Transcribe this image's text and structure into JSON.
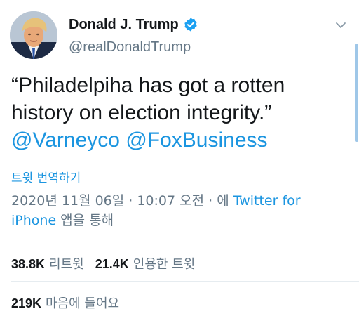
{
  "author": {
    "display_name": "Donald J. Trump",
    "handle": "@realDonaldTrump",
    "verified": true
  },
  "tweet": {
    "text_line1": "“Philadelpiha has got a rotten",
    "text_line2": "history on election integrity.”",
    "mention1": "@Varneyco",
    "mention2": "@FoxBusiness",
    "translate_label": "트윗 번역하기",
    "timestamp": "2020년 11월 06일 · 10:07 오전 · 에 ",
    "source": "Twitter for iPhone",
    "source_suffix": " 앱을 통해"
  },
  "stats": {
    "retweets_count": "38.8K",
    "retweets_label": "리트윗",
    "quotes_count": "21.4K",
    "quotes_label": "인용한 트윗",
    "likes_count": "219K",
    "likes_label": "마음에 들어요"
  },
  "colors": {
    "link": "#1b95e0",
    "muted": "#657786",
    "verified": "#1da1f2"
  }
}
